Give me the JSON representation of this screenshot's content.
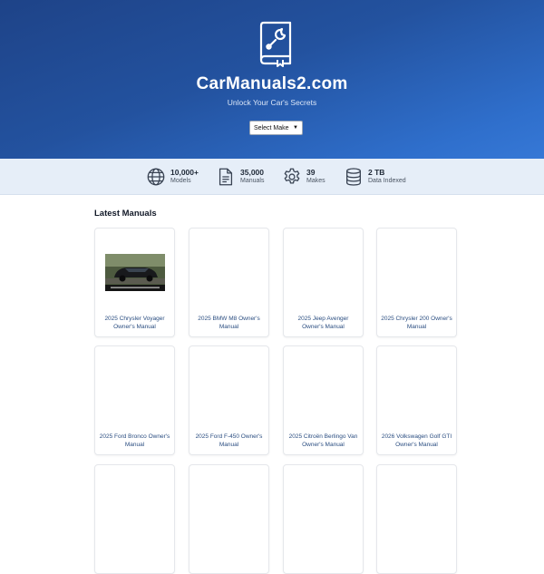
{
  "hero": {
    "title": "CarManuals2.com",
    "subtitle": "Unlock Your Car's Secrets",
    "select_value": "Select Make"
  },
  "stats": [
    {
      "value": "10,000+",
      "label": "Models",
      "icon": "globe-icon"
    },
    {
      "value": "35,000",
      "label": "Manuals",
      "icon": "document-icon"
    },
    {
      "value": "39",
      "label": "Makes",
      "icon": "gear-icon"
    },
    {
      "value": "2 TB",
      "label": "Data Indexed",
      "icon": "database-icon"
    }
  ],
  "latest": {
    "heading": "Latest Manuals",
    "cards": [
      {
        "title": "2025 Chrysler Voyager Owner's Manual",
        "has_image": true
      },
      {
        "title": "2025 BMW M8 Owner's Manual",
        "has_image": false
      },
      {
        "title": "2025 Jeep Avenger Owner's Manual",
        "has_image": false
      },
      {
        "title": "2025 Chrysler 200 Owner's Manual",
        "has_image": false
      },
      {
        "title": "2025 Ford Bronco Owner's Manual",
        "has_image": false
      },
      {
        "title": "2025 Ford F-450 Owner's Manual",
        "has_image": false
      },
      {
        "title": "2025 Citroën Berlingo Van Owner's Manual",
        "has_image": false
      },
      {
        "title": "2026 Volkswagen Golf GTI Owner's Manual",
        "has_image": false
      },
      {
        "title": "",
        "has_image": false
      },
      {
        "title": "",
        "has_image": false
      },
      {
        "title": "",
        "has_image": false
      },
      {
        "title": "",
        "has_image": false
      }
    ]
  },
  "colors": {
    "hero_start": "#1e4388",
    "hero_end": "#3678d6",
    "stats_bg": "#e6eef8",
    "card_title": "#2a4d80"
  }
}
